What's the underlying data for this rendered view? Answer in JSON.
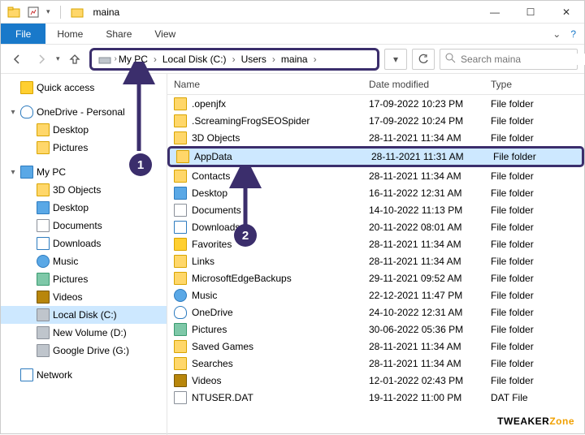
{
  "window": {
    "title": "maina"
  },
  "ribbon": {
    "file": "File",
    "home": "Home",
    "share": "Share",
    "view": "View"
  },
  "breadcrumb": [
    "My PC",
    "Local Disk (C:)",
    "Users",
    "maina"
  ],
  "search": {
    "placeholder": "Search maina"
  },
  "tree": [
    {
      "type": "node",
      "level": 1,
      "expander": "",
      "icon": "star",
      "label": "Quick access"
    },
    {
      "type": "spacer"
    },
    {
      "type": "node",
      "level": 1,
      "expander": "▾",
      "icon": "cloud",
      "label": "OneDrive - Personal"
    },
    {
      "type": "node",
      "level": 2,
      "expander": "",
      "icon": "folder",
      "label": "Desktop"
    },
    {
      "type": "node",
      "level": 2,
      "expander": "",
      "icon": "folder",
      "label": "Pictures"
    },
    {
      "type": "spacer"
    },
    {
      "type": "node",
      "level": 1,
      "expander": "▾",
      "icon": "desktop",
      "label": "My PC"
    },
    {
      "type": "node",
      "level": 2,
      "expander": "",
      "icon": "folder",
      "label": "3D Objects"
    },
    {
      "type": "node",
      "level": 2,
      "expander": "",
      "icon": "desktop",
      "label": "Desktop"
    },
    {
      "type": "node",
      "level": 2,
      "expander": "",
      "icon": "doc",
      "label": "Documents"
    },
    {
      "type": "node",
      "level": 2,
      "expander": "",
      "icon": "down",
      "label": "Downloads"
    },
    {
      "type": "node",
      "level": 2,
      "expander": "",
      "icon": "music",
      "label": "Music"
    },
    {
      "type": "node",
      "level": 2,
      "expander": "",
      "icon": "pic",
      "label": "Pictures"
    },
    {
      "type": "node",
      "level": 2,
      "expander": "",
      "icon": "vid",
      "label": "Videos"
    },
    {
      "type": "node",
      "level": 2,
      "expander": "",
      "icon": "disk",
      "label": "Local Disk (C:)",
      "selected": true
    },
    {
      "type": "node",
      "level": 2,
      "expander": "",
      "icon": "disk",
      "label": "New Volume (D:)"
    },
    {
      "type": "node",
      "level": 2,
      "expander": "",
      "icon": "disk",
      "label": "Google Drive (G:)"
    },
    {
      "type": "spacer"
    },
    {
      "type": "node",
      "level": 1,
      "expander": "",
      "icon": "net",
      "label": "Network"
    }
  ],
  "columns": {
    "name": "Name",
    "date": "Date modified",
    "type": "Type"
  },
  "rows": [
    {
      "icon": "folder",
      "name": ".openjfx",
      "date": "17-09-2022 10:23 PM",
      "type": "File folder"
    },
    {
      "icon": "folder",
      "name": ".ScreamingFrogSEOSpider",
      "date": "17-09-2022 10:24 PM",
      "type": "File folder"
    },
    {
      "icon": "folder",
      "name": "3D Objects",
      "date": "28-11-2021 11:34 AM",
      "type": "File folder"
    },
    {
      "icon": "folder",
      "name": "AppData",
      "date": "28-11-2021 11:31 AM",
      "type": "File folder",
      "selected": true
    },
    {
      "icon": "folder",
      "name": "Contacts",
      "date": "28-11-2021 11:34 AM",
      "type": "File folder"
    },
    {
      "icon": "desktop",
      "name": "Desktop",
      "date": "16-11-2022 12:31 AM",
      "type": "File folder"
    },
    {
      "icon": "doc",
      "name": "Documents",
      "date": "14-10-2022 11:13 PM",
      "type": "File folder"
    },
    {
      "icon": "down",
      "name": "Downloads",
      "date": "20-11-2022 08:01 AM",
      "type": "File folder"
    },
    {
      "icon": "star",
      "name": "Favorites",
      "date": "28-11-2021 11:34 AM",
      "type": "File folder"
    },
    {
      "icon": "folder",
      "name": "Links",
      "date": "28-11-2021 11:34 AM",
      "type": "File folder"
    },
    {
      "icon": "folder",
      "name": "MicrosoftEdgeBackups",
      "date": "29-11-2021 09:52 AM",
      "type": "File folder"
    },
    {
      "icon": "music",
      "name": "Music",
      "date": "22-12-2021 11:47 PM",
      "type": "File folder"
    },
    {
      "icon": "cloud",
      "name": "OneDrive",
      "date": "24-10-2022 12:31 AM",
      "type": "File folder"
    },
    {
      "icon": "pic",
      "name": "Pictures",
      "date": "30-06-2022 05:36 PM",
      "type": "File folder"
    },
    {
      "icon": "folder",
      "name": "Saved Games",
      "date": "28-11-2021 11:34 AM",
      "type": "File folder"
    },
    {
      "icon": "folder",
      "name": "Searches",
      "date": "28-11-2021 11:34 AM",
      "type": "File folder"
    },
    {
      "icon": "vid",
      "name": "Videos",
      "date": "12-01-2022 02:43 PM",
      "type": "File folder"
    },
    {
      "icon": "doc",
      "name": "NTUSER.DAT",
      "date": "19-11-2022 11:00 PM",
      "type": "DAT File"
    }
  ],
  "annotations": {
    "step1": "1",
    "step2": "2"
  },
  "brand": {
    "part1": "TWEAKER",
    "part2": "Zone"
  }
}
